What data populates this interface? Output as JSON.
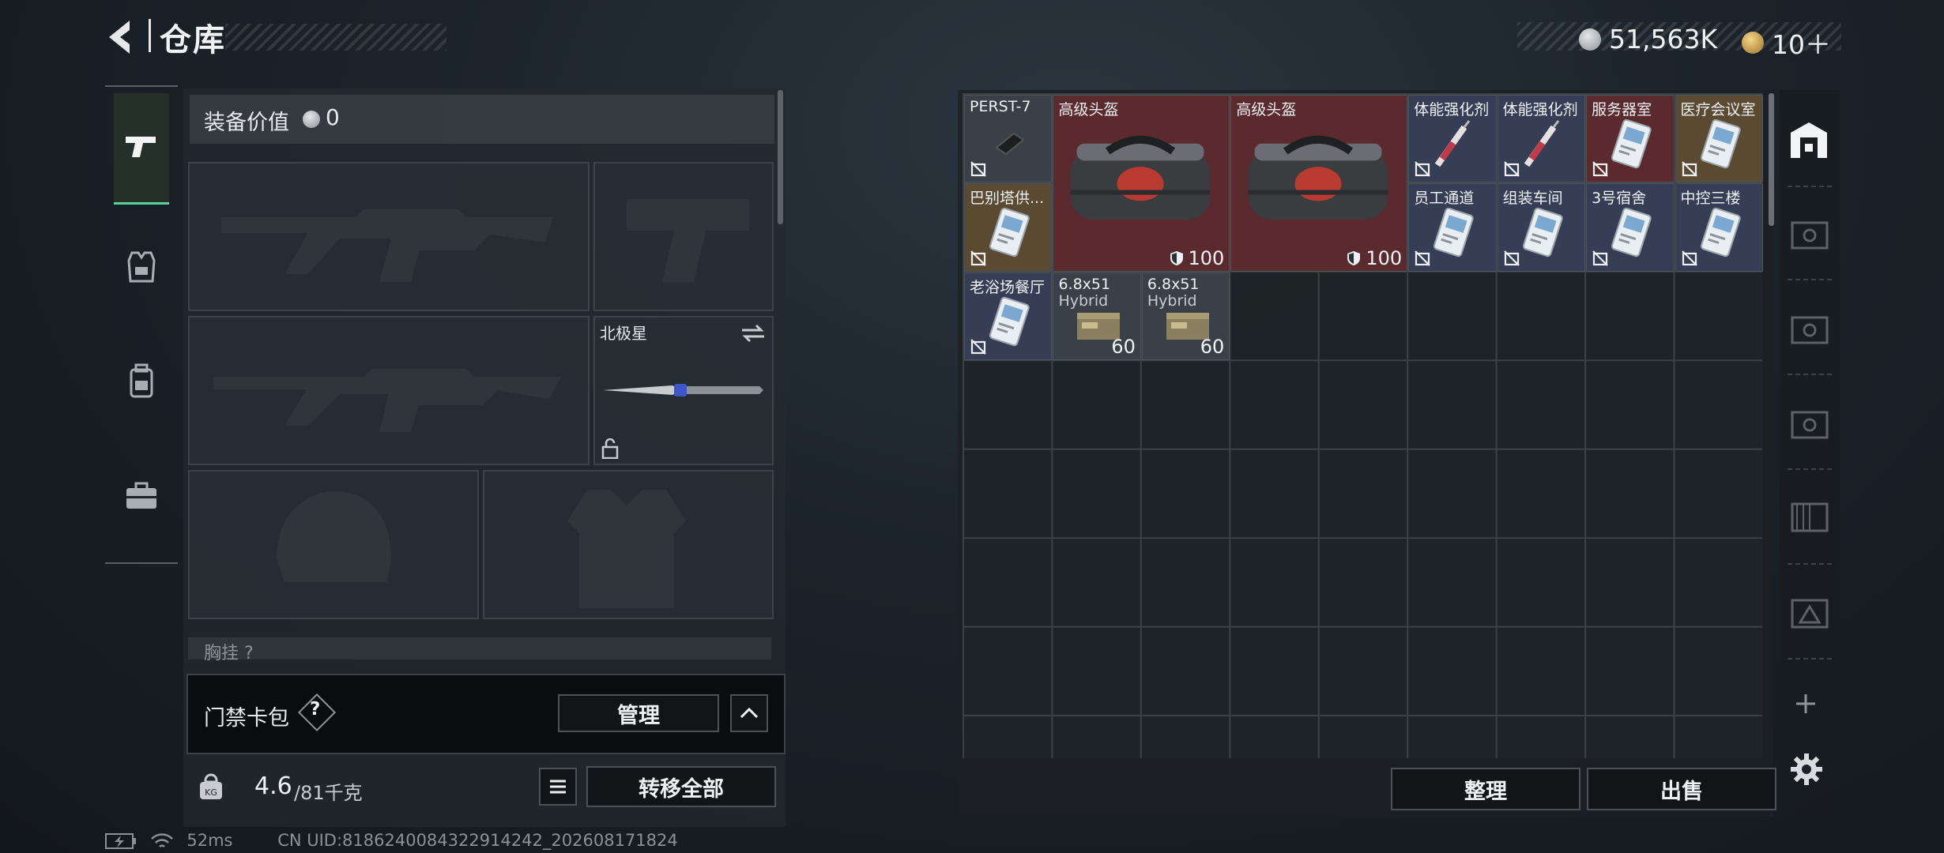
{
  "header": {
    "title": "仓库",
    "currency_amount": "51,563K",
    "premium_amount": "10＋",
    "colors": {
      "coin": "#a8acb0",
      "premium": "#c79a3a"
    }
  },
  "loadout": {
    "value_label": "装备价值",
    "value": "0",
    "melee_slot_label": "北极星",
    "chest_label": "胸挂 ?"
  },
  "keycard": {
    "label": "门禁卡包",
    "help": "?",
    "manage_label": "管理"
  },
  "weight": {
    "current": "4.6",
    "max": "/81千克",
    "transfer_all_label": "转移全部"
  },
  "stash": {
    "sort_label": "整理",
    "sell_label": "出售",
    "items": [
      {
        "name": "PERST-7",
        "bg": "gray",
        "icon": "device-icon"
      },
      {
        "name": "高级头盔",
        "bg": "red",
        "icon": "duffel-bag-icon",
        "durability": "100"
      },
      {
        "name": "高级头盔",
        "bg": "red",
        "icon": "duffel-bag-icon",
        "durability": "100"
      },
      {
        "name": "体能强化剂",
        "bg": "blue",
        "icon": "syringe-icon"
      },
      {
        "name": "体能强化剂",
        "bg": "blue",
        "icon": "syringe-icon"
      },
      {
        "name": "服务器室",
        "bg": "red",
        "icon": "keycard-icon"
      },
      {
        "name": "医疗会议室",
        "bg": "gold",
        "icon": "keycard-icon"
      },
      {
        "name": "巴别塔供...",
        "bg": "gold",
        "icon": "keycard-icon"
      },
      {
        "name": "员工通道",
        "bg": "blue",
        "icon": "keycard-icon"
      },
      {
        "name": "组装车间",
        "bg": "blue",
        "icon": "keycard-icon"
      },
      {
        "name": "3号宿舍",
        "bg": "blue",
        "icon": "keycard-icon"
      },
      {
        "name": "中控三楼",
        "bg": "blue",
        "icon": "keycard-icon"
      },
      {
        "name": "老浴场餐厅",
        "bg": "blue",
        "icon": "keycard-icon"
      },
      {
        "name": "6.8x51",
        "name2": "Hybrid",
        "bg": "gray",
        "icon": "ammo-box-icon",
        "count": "60"
      },
      {
        "name": "6.8x51",
        "name2": "Hybrid",
        "bg": "gray",
        "icon": "ammo-box-icon",
        "count": "60"
      }
    ]
  },
  "footer": {
    "ping": "52ms",
    "uid": "CN UID:8186240084322914242_202608171824"
  }
}
